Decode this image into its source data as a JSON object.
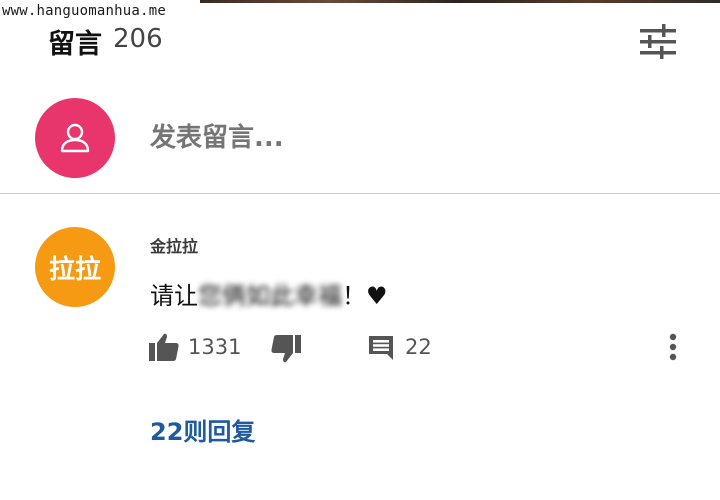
{
  "watermark": "www.hanguomanhua.me",
  "header": {
    "title": "留言",
    "count": "206",
    "filter_icon": "tune-icon"
  },
  "compose": {
    "avatar_icon": "person-icon",
    "placeholder": "发表留言..."
  },
  "comments": [
    {
      "author": "金拉拉",
      "avatar_text": "拉拉",
      "text_prefix": "请让",
      "text_blurred": "您俩如此幸福",
      "text_suffix": "！♥",
      "likes": "1331",
      "replies": "22",
      "replies_link": "22则回复"
    }
  ],
  "colors": {
    "self_avatar": "#e8356c",
    "comment_avatar": "#f59a12",
    "link": "#1e5aa0"
  }
}
